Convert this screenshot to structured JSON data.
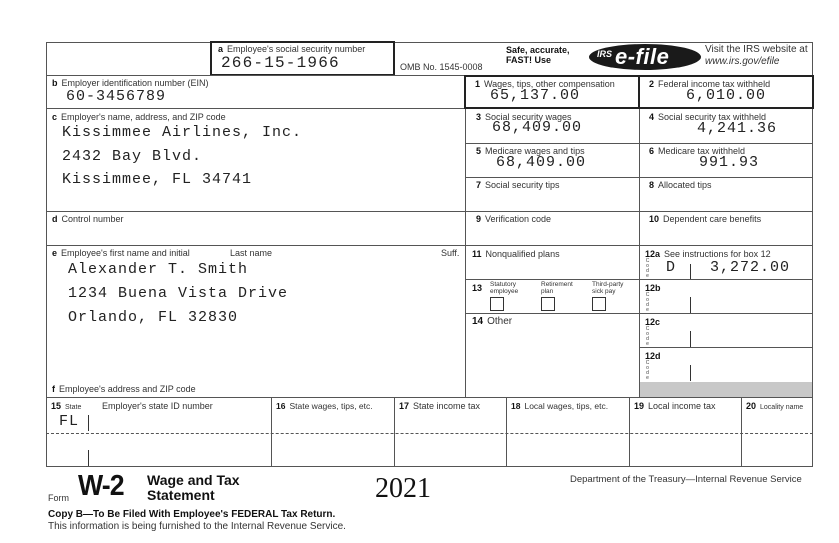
{
  "header": {
    "ssn_label_letter": "a",
    "ssn_label": "Employee's social security number",
    "ssn_value": "266-15-1966",
    "omb": "OMB No. 1545-0008",
    "efile_promo_line1": "Safe, accurate,",
    "efile_promo_line2": "FAST! Use",
    "efile_logo_irs": "IRS",
    "efile_logo_text": "e-file",
    "visit_line1": "Visit the IRS website at",
    "visit_line2": "www.irs.gov/efile"
  },
  "employer": {
    "ein_letter": "b",
    "ein_label": "Employer identification number (EIN)",
    "ein_value": "60-3456789",
    "name_letter": "c",
    "name_label": "Employer's name, address, and ZIP code",
    "name_lines": [
      "Kissimmee Airlines, Inc.",
      "2432 Bay Blvd.",
      "Kissimmee, FL 34741"
    ],
    "control_letter": "d",
    "control_label": "Control number"
  },
  "employee": {
    "name_letter": "e",
    "first_label": "Employee's first name and initial",
    "last_label": "Last name",
    "suff_label": "Suff.",
    "name_lines": [
      "Alexander T. Smith",
      "1234 Buena Vista Drive",
      "Orlando, FL 32830"
    ],
    "address_letter": "f",
    "address_label": "Employee's address and ZIP code"
  },
  "boxes": {
    "b1": {
      "num": "1",
      "label": "Wages, tips, other compensation",
      "value": "65,137.00"
    },
    "b2": {
      "num": "2",
      "label": "Federal income tax withheld",
      "value": "6,010.00"
    },
    "b3": {
      "num": "3",
      "label": "Social security wages",
      "value": "68,409.00"
    },
    "b4": {
      "num": "4",
      "label": "Social security tax withheld",
      "value": "4,241.36"
    },
    "b5": {
      "num": "5",
      "label": "Medicare wages and tips",
      "value": "68,409.00"
    },
    "b6": {
      "num": "6",
      "label": "Medicare tax withheld",
      "value": "991.93"
    },
    "b7": {
      "num": "7",
      "label": "Social security tips",
      "value": ""
    },
    "b8": {
      "num": "8",
      "label": "Allocated tips",
      "value": ""
    },
    "b9": {
      "num": "9",
      "label": "Verification code",
      "value": ""
    },
    "b10": {
      "num": "10",
      "label": "Dependent care benefits",
      "value": ""
    },
    "b11": {
      "num": "11",
      "label": "Nonqualified plans",
      "value": ""
    },
    "b12a": {
      "num": "12a",
      "label": "See instructions for box 12",
      "code": "D",
      "value": "3,272.00"
    },
    "b12b": {
      "num": "12b",
      "code": "",
      "value": ""
    },
    "b12c": {
      "num": "12c",
      "code": "",
      "value": ""
    },
    "b12d": {
      "num": "12d",
      "code": "",
      "value": ""
    },
    "code_vertical": "C o d e",
    "b13": {
      "num": "13",
      "statutory_line1": "Statutory",
      "statutory_line2": "employee",
      "retirement_line1": "Retirement",
      "retirement_line2": "plan",
      "sick_line1": "Third-party",
      "sick_line2": "sick pay",
      "statutory_checked": false,
      "retirement_checked": false,
      "sick_checked": false
    },
    "b14": {
      "num": "14",
      "label": "Other",
      "value": ""
    }
  },
  "state_local": {
    "b15_num": "15",
    "b15_state_label": "State",
    "b15_id_label": "Employer's state ID number",
    "b16_num": "16",
    "b16_label": "State wages, tips, etc.",
    "b17_num": "17",
    "b17_label": "State income tax",
    "b18_num": "18",
    "b18_label": "Local wages, tips, etc.",
    "b19_num": "19",
    "b19_label": "Local income tax",
    "b20_num": "20",
    "b20_label": "Locality name",
    "rows": [
      {
        "state": "FL",
        "state_id": "",
        "state_wages": "",
        "state_tax": "",
        "local_wages": "",
        "local_tax": "",
        "locality": ""
      },
      {
        "state": "",
        "state_id": "",
        "state_wages": "",
        "state_tax": "",
        "local_wages": "",
        "local_tax": "",
        "locality": ""
      }
    ]
  },
  "footer": {
    "form_word": "Form",
    "form_code": "W-2",
    "title_line1": "Wage and Tax",
    "title_line2": "Statement",
    "year": "2021",
    "department": "Department of the Treasury—Internal Revenue Service",
    "copy_line": "Copy B—To Be Filed With Employee's FEDERAL Tax Return.",
    "info_line": "This information is being furnished to the Internal Revenue Service."
  }
}
